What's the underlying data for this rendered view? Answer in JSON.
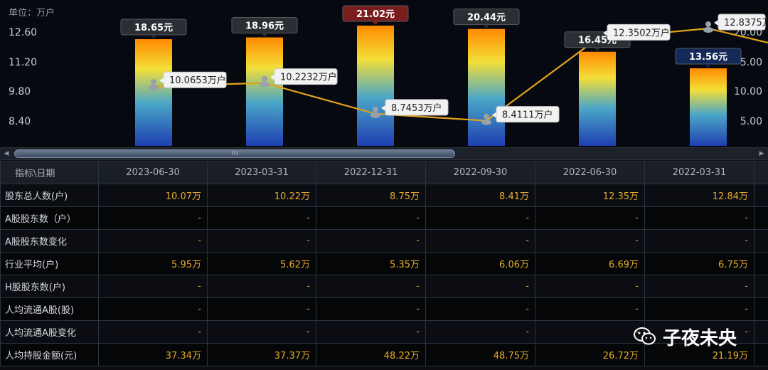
{
  "chart_data": {
    "type": "bar",
    "unit_label": "单位：万户",
    "categories": [
      "2023-06-30",
      "2023-03-31",
      "2022-12-31",
      "2022-09-30",
      "2022-06-30",
      "2022-03-31"
    ],
    "bar_values": [
      18.65,
      18.96,
      21.02,
      20.44,
      16.45,
      13.56
    ],
    "bar_labels": [
      "18.65元",
      "18.96元",
      "21.02元",
      "20.44元",
      "16.45元",
      "13.56元"
    ],
    "line_values": [
      10.0653,
      10.2232,
      8.7453,
      8.4111,
      12.3502,
      12.8375
    ],
    "line_labels": [
      "10.0653万户",
      "10.2232万户",
      "8.7453万户",
      "8.4111万户",
      "12.3502万户",
      "12.8375万"
    ],
    "left_ticks": [
      "12.60",
      "11.20",
      "9.80",
      "8.40"
    ],
    "right_ticks": [
      "20.00",
      "5.00",
      "10.00",
      "5.00"
    ],
    "colors": {
      "line": "#e2a31c",
      "bar_top": "#ff9a00",
      "bar_mid": "#f2e23a",
      "bar_bottom": "#1d4fbf"
    }
  },
  "table": {
    "header_first": "指标\\日期",
    "columns": [
      "2023-06-30",
      "2023-03-31",
      "2022-12-31",
      "2022-09-30",
      "2022-06-30",
      "2022-03-31"
    ],
    "rows": [
      {
        "label": "股东总人数(户)",
        "values": [
          "10.07万",
          "10.22万",
          "8.75万",
          "8.41万",
          "12.35万",
          "12.84万"
        ]
      },
      {
        "label": "A股股东数（户）",
        "values": [
          "-",
          "-",
          "-",
          "-",
          "-",
          "-"
        ]
      },
      {
        "label": "A股股东数变化",
        "values": [
          "-",
          "-",
          "-",
          "-",
          "-",
          "-"
        ]
      },
      {
        "label": "行业平均(户)",
        "values": [
          "5.95万",
          "5.62万",
          "5.35万",
          "6.06万",
          "6.69万",
          "6.75万"
        ]
      },
      {
        "label": "H股股东数(户)",
        "values": [
          "-",
          "-",
          "-",
          "-",
          "-",
          "-"
        ]
      },
      {
        "label": "人均流通A股(股)",
        "values": [
          "-",
          "-",
          "-",
          "-",
          "-",
          "-"
        ]
      },
      {
        "label": "人均流通A股变化",
        "values": [
          "-",
          "-",
          "-",
          "-",
          "-",
          "-"
        ]
      },
      {
        "label": "人均持股金额(元)",
        "values": [
          "37.34万",
          "37.37万",
          "48.22万",
          "48.75万",
          "26.72万",
          "21.19万"
        ]
      }
    ]
  },
  "watermark": {
    "text": "子夜未央",
    "icon": "wechat-icon"
  },
  "scrollbar": {
    "grip": "III"
  }
}
